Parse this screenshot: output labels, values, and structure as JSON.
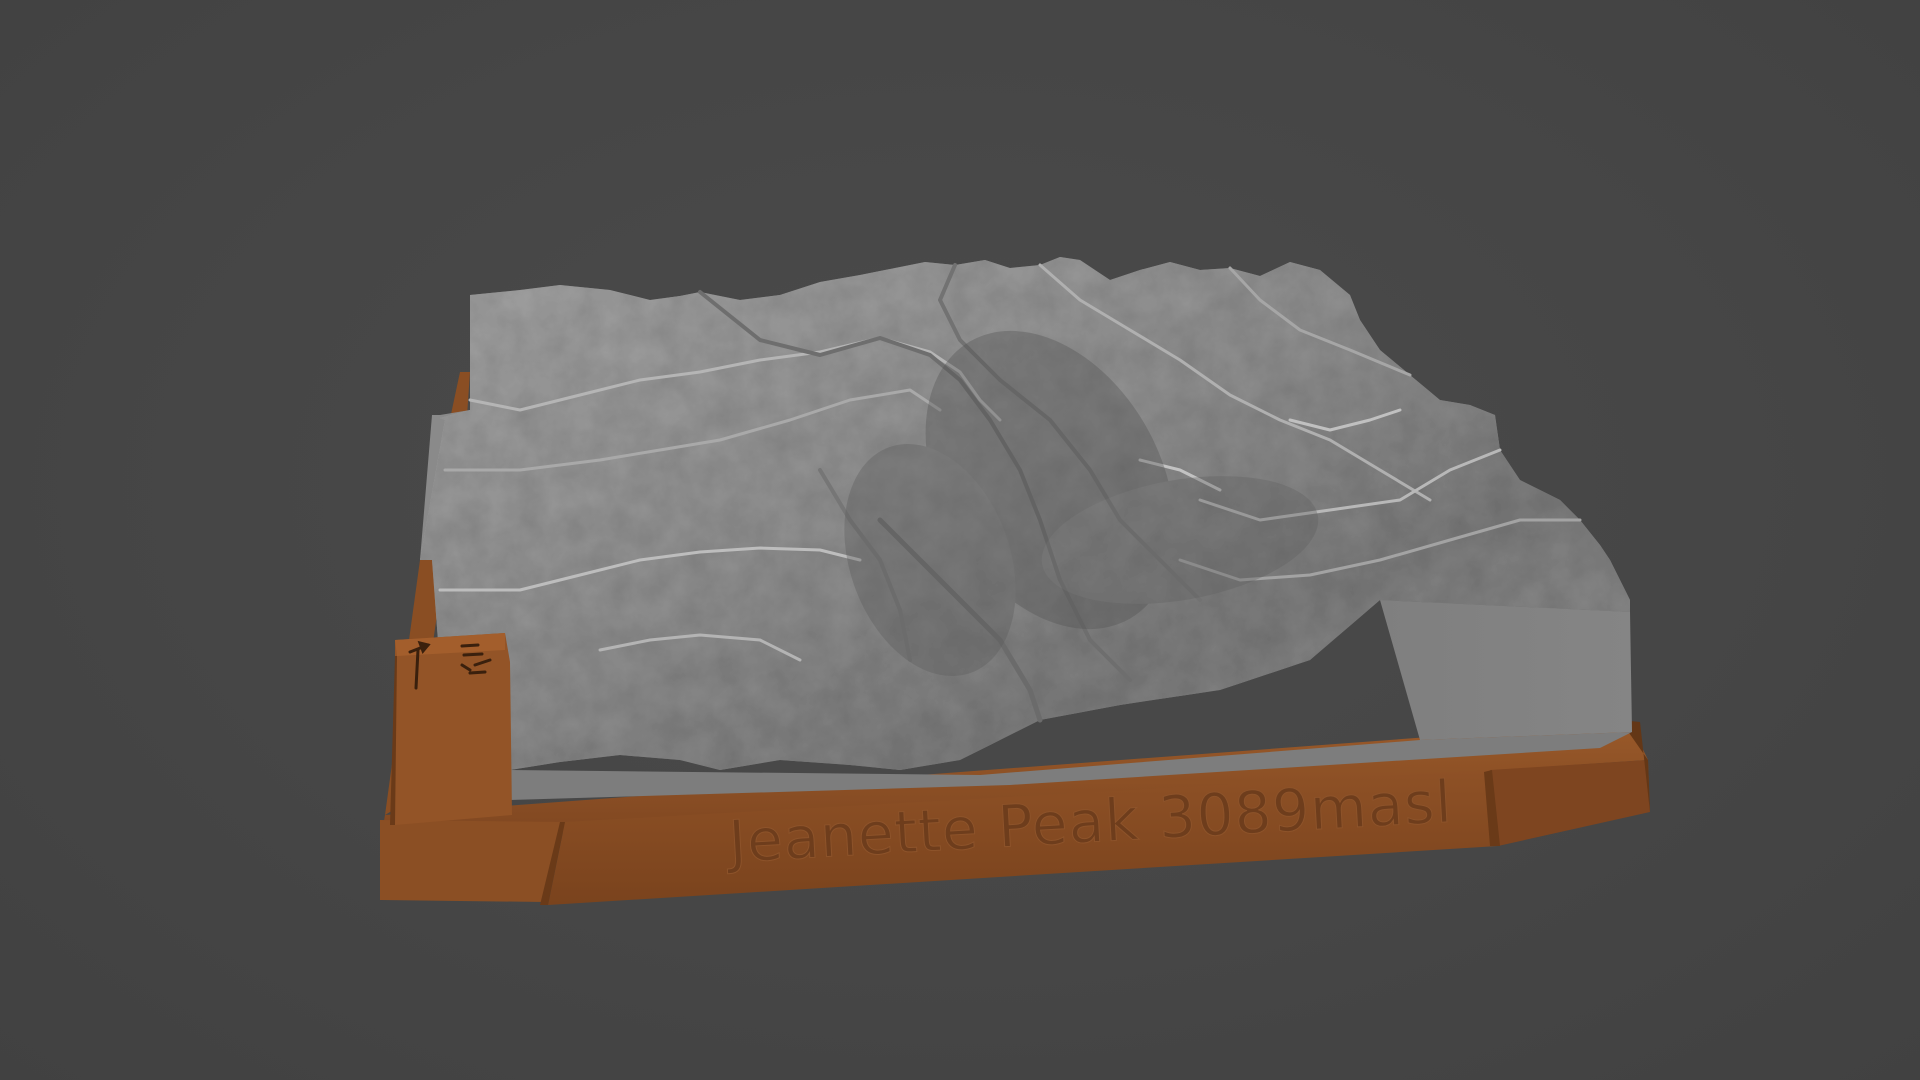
{
  "scene": {
    "background_color": "#464646",
    "object": "3D printed terrain relief model on a wooden base",
    "terrain_color": "#8c8c8c",
    "base_color": "#8a4e23",
    "base_shadow_color": "#6a3a18"
  },
  "plaque": {
    "engraved_text": "Jeanette Peak 3089masl"
  },
  "marker": {
    "icon": "compass-north-arrow-icon"
  }
}
